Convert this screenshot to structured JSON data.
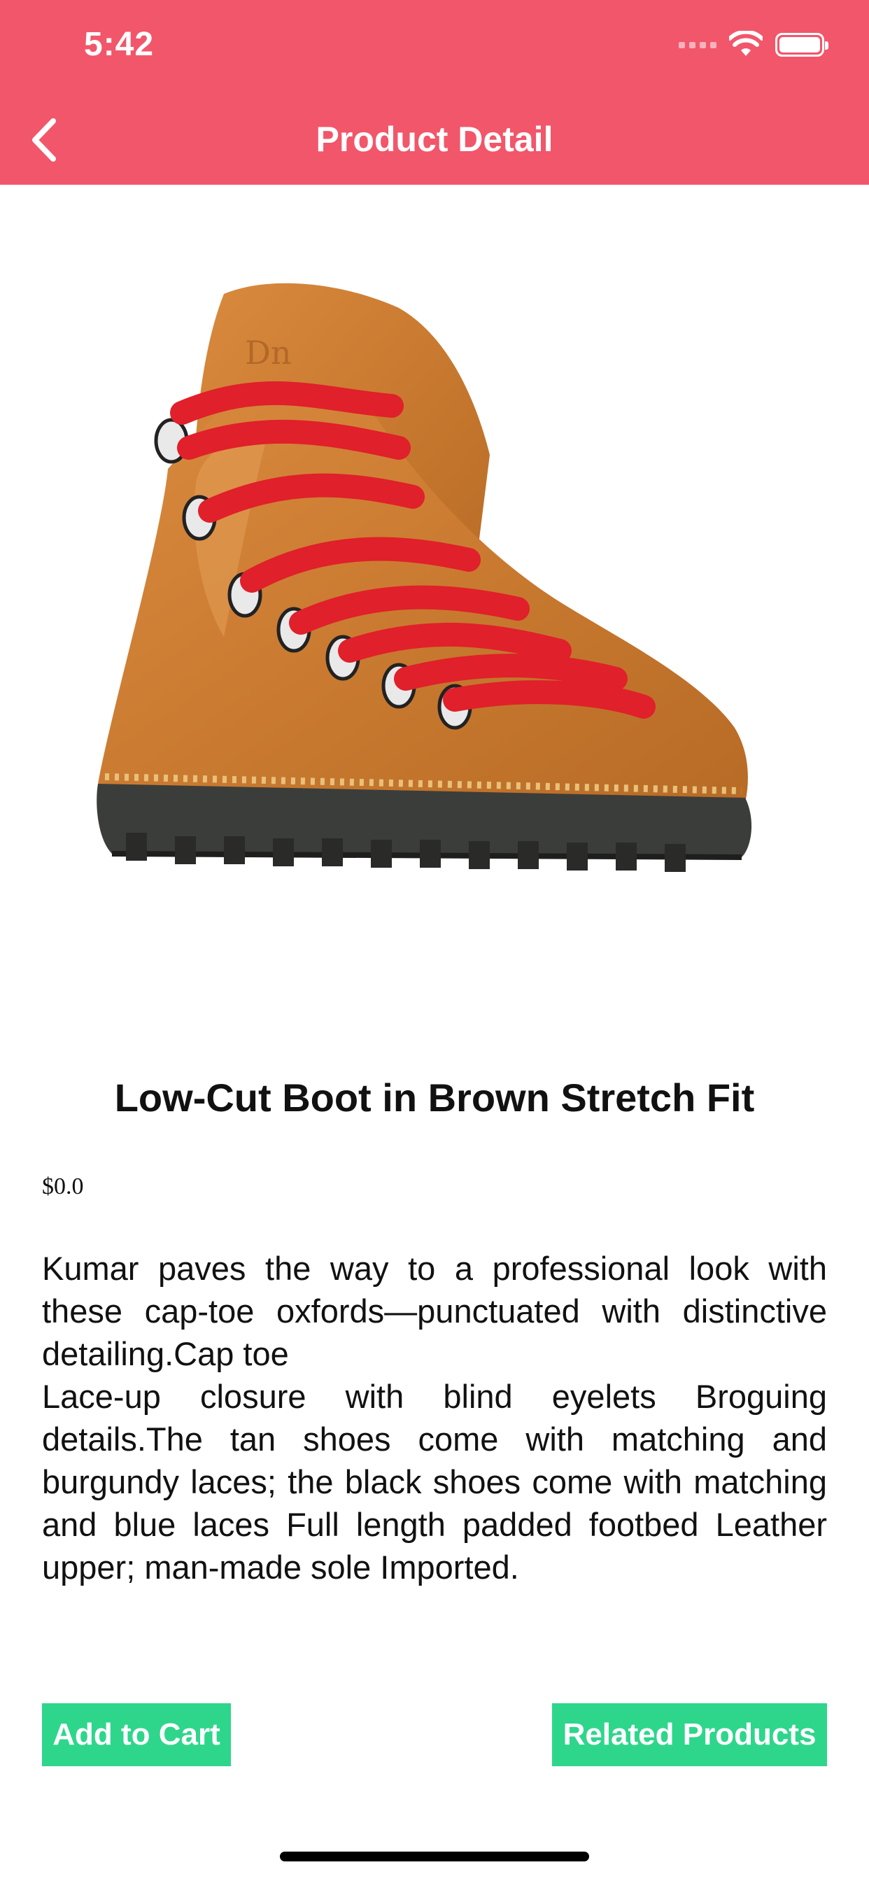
{
  "status_bar": {
    "time": "5:42"
  },
  "header": {
    "title": "Product Detail"
  },
  "product": {
    "title": "Low-Cut Boot in Brown Stretch Fit",
    "price": "$0.0",
    "description": "Kumar paves the way to a professional look with these cap-toe oxfords—punctuated with distinctive detailing.Cap toe\nLace-up closure with blind eyelets Broguing details.The tan shoes come with matching and burgundy laces; the black shoes come with matching and blue laces Full length padded footbed Leather upper; man-made sole Imported."
  },
  "actions": {
    "add_to_cart_label": "Add to Cart",
    "related_products_label": "Related Products"
  },
  "colors": {
    "header": "#F2566A",
    "button": "#2ED68C"
  }
}
